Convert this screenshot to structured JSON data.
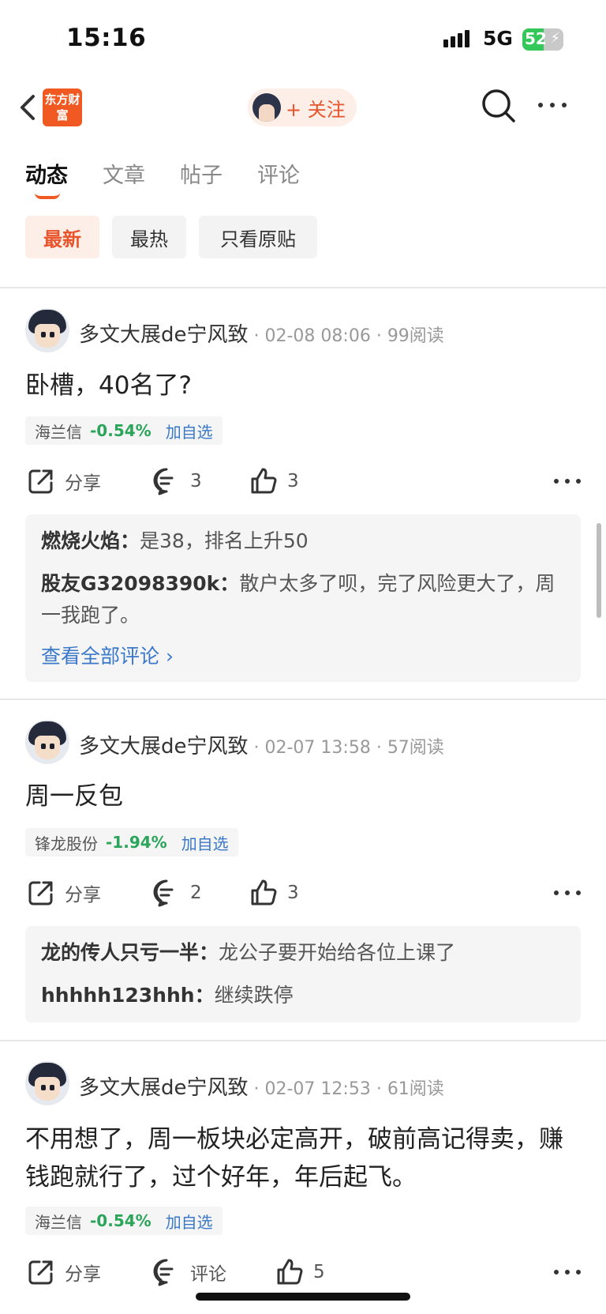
{
  "status_bar": {
    "time": "15:16",
    "network": "5G",
    "battery": "52",
    "battery_level": 0.52
  },
  "nav": {
    "logo": "东方财富",
    "follow_label": "+ 关注"
  },
  "tabs": [
    {
      "label": "动态",
      "active": true
    },
    {
      "label": "文章"
    },
    {
      "label": "帖子"
    },
    {
      "label": "评论"
    }
  ],
  "filters": [
    {
      "label": "最新",
      "active": true
    },
    {
      "label": "最热"
    },
    {
      "label": "只看原贴"
    }
  ],
  "posts": [
    {
      "author": "多文大展de宁风致",
      "sep": " · ",
      "date": "02-08 08:06",
      "reads": "99阅读",
      "content": "卧槽，40名了?",
      "stock": {
        "name": "海兰信",
        "change": "-0.54%",
        "add": "加自选"
      },
      "actions": {
        "share": "分享",
        "comment": "3",
        "like": "3"
      },
      "comments": [
        {
          "user": "燃烧火焰：",
          "text": "是38，排名上升50"
        },
        {
          "user": "股友G32098390k：",
          "text": "散户太多了呗，完了风险更大了，周一我跑了。"
        }
      ],
      "view_all": "查看全部评论 ›"
    },
    {
      "author": "多文大展de宁风致",
      "sep": " · ",
      "date": "02-07 13:58",
      "reads": "57阅读",
      "content": "周一反包",
      "stock": {
        "name": "锋龙股份",
        "change": "-1.94%",
        "add": "加自选"
      },
      "actions": {
        "share": "分享",
        "comment": "2",
        "like": "3"
      },
      "comments": [
        {
          "user": "龙的传人只亏一半：",
          "text": "龙公子要开始给各位上课了"
        },
        {
          "user": "hhhhh123hhh：",
          "text": "继续跌停"
        }
      ]
    },
    {
      "author": "多文大展de宁风致",
      "sep": " · ",
      "date": "02-07 12:53",
      "reads": "61阅读",
      "content": "不用想了，周一板块必定高开，破前高记得卖，赚钱跑就行了，过个好年，年后起飞。",
      "stock": {
        "name": "海兰信",
        "change": "-0.54%",
        "add": "加自选"
      },
      "actions": {
        "share": "分享",
        "comment": "评论",
        "like": "5"
      }
    }
  ]
}
